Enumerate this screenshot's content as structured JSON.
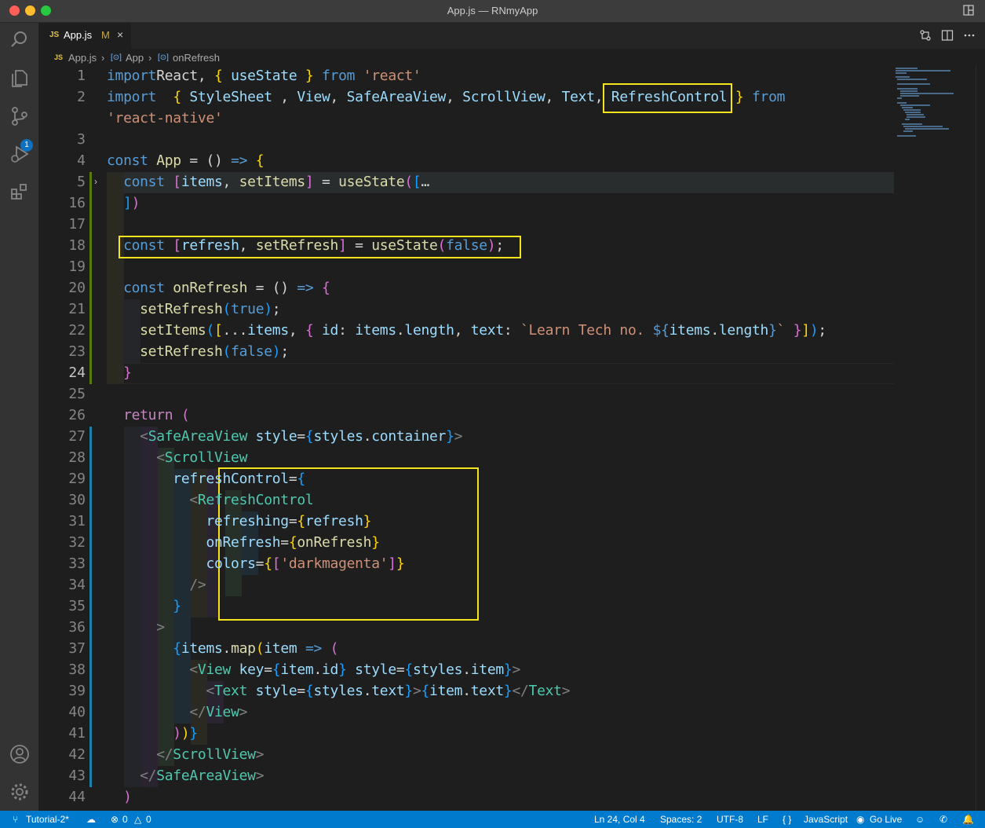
{
  "window": {
    "title": "App.js — RNmyApp"
  },
  "activity_bar": {
    "items": [
      "search-icon",
      "files-icon",
      "source-control-icon",
      "run-debug-icon",
      "extensions-icon",
      "account-icon",
      "settings-gear-icon"
    ],
    "source_control_badge": "1"
  },
  "tab": {
    "lang_badge": "JS",
    "name": "App.js",
    "modified": "M",
    "close": "×"
  },
  "breadcrumb": {
    "file_badge": "JS",
    "file": "App.js",
    "sym_badge": "[⊙]",
    "symbol1": "App",
    "symbol2": "onRefresh",
    "sep": "›"
  },
  "editor": {
    "lines": [
      {
        "n": "1",
        "tokens": [
          [
            "kw",
            "import"
          ],
          [
            "",
            "React, "
          ],
          [
            "br1",
            "{"
          ],
          [
            "var",
            " useState "
          ],
          [
            "br1",
            "}"
          ],
          [
            "kw",
            " from "
          ],
          [
            "str",
            "'react'"
          ]
        ]
      },
      {
        "n": "2",
        "tokens": [
          [
            "kw",
            "import"
          ],
          [
            "",
            "  "
          ],
          [
            "br1",
            "{"
          ],
          [
            "var",
            " StyleSheet"
          ],
          [
            "",
            " , "
          ],
          [
            "var",
            "View"
          ],
          [
            "",
            ", "
          ],
          [
            "var",
            "SafeAreaView"
          ],
          [
            "",
            ", "
          ],
          [
            "var",
            "ScrollView"
          ],
          [
            "",
            ", "
          ],
          [
            "var",
            "Text"
          ],
          [
            "",
            ", "
          ],
          [
            "var",
            "RefreshControl"
          ],
          [
            "",
            ""
          ],
          [
            "br1",
            " }"
          ],
          [
            "kw",
            " from"
          ]
        ]
      },
      {
        "n": "",
        "tokens": [
          [
            "str",
            "'react-native'"
          ]
        ]
      },
      {
        "n": "3",
        "tokens": []
      },
      {
        "n": "4",
        "tokens": [
          [
            "kw",
            "const "
          ],
          [
            "fn",
            "App"
          ],
          [
            "",
            " = () "
          ],
          [
            "kw",
            "=>"
          ],
          [
            "br1",
            " {"
          ]
        ]
      },
      {
        "n": "5",
        "tokens": [
          [
            "kw",
            "  const "
          ],
          [
            "br2",
            "["
          ],
          [
            "var",
            "items"
          ],
          [
            "",
            ", "
          ],
          [
            "fn",
            "setItems"
          ],
          [
            "br2",
            "]"
          ],
          [
            "",
            " = "
          ],
          [
            "fn",
            "useState"
          ],
          [
            "br2",
            "("
          ],
          [
            "br3",
            "["
          ],
          [
            "",
            "…"
          ]
        ]
      },
      {
        "n": "16",
        "tokens": [
          [
            "br3",
            "  ]"
          ],
          [
            "br2",
            ")"
          ]
        ]
      },
      {
        "n": "17",
        "tokens": []
      },
      {
        "n": "18",
        "tokens": [
          [
            "kw",
            "  const "
          ],
          [
            "br2",
            "["
          ],
          [
            "var",
            "refresh"
          ],
          [
            "",
            ", "
          ],
          [
            "fn",
            "setRefresh"
          ],
          [
            "br2",
            "]"
          ],
          [
            "",
            " = "
          ],
          [
            "fn",
            "useState"
          ],
          [
            "br2",
            "("
          ],
          [
            "kw",
            "false"
          ],
          [
            "br2",
            ")"
          ],
          [
            "",
            ";"
          ]
        ]
      },
      {
        "n": "19",
        "tokens": []
      },
      {
        "n": "20",
        "tokens": [
          [
            "kw",
            "  const "
          ],
          [
            "fn",
            "onRefresh"
          ],
          [
            "",
            " = () "
          ],
          [
            "kw",
            "=>"
          ],
          [
            "br2",
            " {"
          ]
        ]
      },
      {
        "n": "21",
        "tokens": [
          [
            "fn",
            "    setRefresh"
          ],
          [
            "br3",
            "("
          ],
          [
            "kw",
            "true"
          ],
          [
            "br3",
            ")"
          ],
          [
            "",
            ";"
          ]
        ]
      },
      {
        "n": "22",
        "tokens": [
          [
            "fn",
            "    setItems"
          ],
          [
            "br3",
            "("
          ],
          [
            "br1",
            "["
          ],
          [
            "",
            "..."
          ],
          [
            "var",
            "items"
          ],
          [
            "",
            ", "
          ],
          [
            "br2",
            "{"
          ],
          [
            "var",
            " id"
          ],
          [
            "",
            ": "
          ],
          [
            "var",
            "items"
          ],
          [
            "",
            "."
          ],
          [
            "var",
            "length"
          ],
          [
            "",
            ", "
          ],
          [
            "var",
            "text"
          ],
          [
            "",
            ": "
          ],
          [
            "str",
            "`Learn Tech no. "
          ],
          [
            "kw",
            "${"
          ],
          [
            "var",
            "items"
          ],
          [
            "",
            "."
          ],
          [
            "var",
            "length"
          ],
          [
            "kw",
            "}"
          ],
          [
            "str",
            "`"
          ],
          [
            "br2",
            " }"
          ],
          [
            "br1",
            "]"
          ],
          [
            "br3",
            ")"
          ],
          [
            "",
            ";"
          ]
        ]
      },
      {
        "n": "23",
        "tokens": [
          [
            "fn",
            "    setRefresh"
          ],
          [
            "br3",
            "("
          ],
          [
            "kw",
            "false"
          ],
          [
            "br3",
            ")"
          ],
          [
            "",
            ";"
          ]
        ]
      },
      {
        "n": "24",
        "tokens": [
          [
            "br2",
            "  }"
          ]
        ]
      },
      {
        "n": "25",
        "tokens": []
      },
      {
        "n": "26",
        "tokens": [
          [
            "ctl",
            "  return"
          ],
          [
            "br2",
            " ("
          ]
        ]
      },
      {
        "n": "27",
        "tokens": [
          [
            "tagp",
            "    <"
          ],
          [
            "cls",
            "SafeAreaView"
          ],
          [
            "var",
            " style"
          ],
          [
            "",
            "="
          ],
          [
            "br3",
            "{"
          ],
          [
            "var",
            "styles"
          ],
          [
            "",
            "."
          ],
          [
            "var",
            "container"
          ],
          [
            "br3",
            "}"
          ],
          [
            "tagp",
            ">"
          ]
        ]
      },
      {
        "n": "28",
        "tokens": [
          [
            "tagp",
            "      <"
          ],
          [
            "cls",
            "ScrollView"
          ]
        ]
      },
      {
        "n": "29",
        "tokens": [
          [
            "var",
            "        refreshControl"
          ],
          [
            "",
            "="
          ],
          [
            "br3",
            "{"
          ]
        ]
      },
      {
        "n": "30",
        "tokens": [
          [
            "tagp",
            "          <"
          ],
          [
            "cls",
            "RefreshControl"
          ]
        ]
      },
      {
        "n": "31",
        "tokens": [
          [
            "var",
            "            refreshing"
          ],
          [
            "",
            "="
          ],
          [
            "br1",
            "{"
          ],
          [
            "var",
            "refresh"
          ],
          [
            "br1",
            "}"
          ]
        ]
      },
      {
        "n": "32",
        "tokens": [
          [
            "var",
            "            onRefresh"
          ],
          [
            "",
            "="
          ],
          [
            "br1",
            "{"
          ],
          [
            "fn",
            "onRefresh"
          ],
          [
            "br1",
            "}"
          ]
        ]
      },
      {
        "n": "33",
        "tokens": [
          [
            "var",
            "            colors"
          ],
          [
            "",
            "="
          ],
          [
            "br1",
            "{"
          ],
          [
            "br2",
            "["
          ],
          [
            "str",
            "'darkmagenta'"
          ],
          [
            "br2",
            "]"
          ],
          [
            "br1",
            "}"
          ]
        ]
      },
      {
        "n": "34",
        "tokens": [
          [
            "tagp",
            "          />"
          ]
        ]
      },
      {
        "n": "35",
        "tokens": [
          [
            "br3",
            "        }"
          ]
        ]
      },
      {
        "n": "36",
        "tokens": [
          [
            "tagp",
            "      >"
          ]
        ]
      },
      {
        "n": "37",
        "tokens": [
          [
            "br3",
            "        {"
          ],
          [
            "var",
            "items"
          ],
          [
            "",
            "."
          ],
          [
            "fn",
            "map"
          ],
          [
            "br1",
            "("
          ],
          [
            "var",
            "item"
          ],
          [
            "kw",
            " =>"
          ],
          [
            "br2",
            " ("
          ]
        ]
      },
      {
        "n": "38",
        "tokens": [
          [
            "tagp",
            "          <"
          ],
          [
            "cls",
            "View"
          ],
          [
            "var",
            " key"
          ],
          [
            "",
            "="
          ],
          [
            "br3",
            "{"
          ],
          [
            "var",
            "item"
          ],
          [
            "",
            "."
          ],
          [
            "var",
            "id"
          ],
          [
            "br3",
            "}"
          ],
          [
            "var",
            " style"
          ],
          [
            "",
            "="
          ],
          [
            "br3",
            "{"
          ],
          [
            "var",
            "styles"
          ],
          [
            "",
            "."
          ],
          [
            "var",
            "item"
          ],
          [
            "br3",
            "}"
          ],
          [
            "tagp",
            ">"
          ]
        ]
      },
      {
        "n": "39",
        "tokens": [
          [
            "tagp",
            "            <"
          ],
          [
            "cls",
            "Text"
          ],
          [
            "var",
            " style"
          ],
          [
            "",
            "="
          ],
          [
            "br3",
            "{"
          ],
          [
            "var",
            "styles"
          ],
          [
            "",
            "."
          ],
          [
            "var",
            "text"
          ],
          [
            "br3",
            "}"
          ],
          [
            "tagp",
            ">"
          ],
          [
            "br3",
            "{"
          ],
          [
            "var",
            "item"
          ],
          [
            "",
            "."
          ],
          [
            "var",
            "text"
          ],
          [
            "br3",
            "}"
          ],
          [
            "tagp",
            "</"
          ],
          [
            "cls",
            "Text"
          ],
          [
            "tagp",
            ">"
          ]
        ]
      },
      {
        "n": "40",
        "tokens": [
          [
            "tagp",
            "          </"
          ],
          [
            "cls",
            "View"
          ],
          [
            "tagp",
            ">"
          ]
        ]
      },
      {
        "n": "41",
        "tokens": [
          [
            "br2",
            "        )"
          ],
          [
            "br1",
            ")"
          ],
          [
            "br3",
            "}"
          ]
        ]
      },
      {
        "n": "42",
        "tokens": [
          [
            "tagp",
            "      </"
          ],
          [
            "cls",
            "ScrollView"
          ],
          [
            "tagp",
            ">"
          ]
        ]
      },
      {
        "n": "43",
        "tokens": [
          [
            "tagp",
            "    </"
          ],
          [
            "cls",
            "SafeAreaView"
          ],
          [
            "tagp",
            ">"
          ]
        ]
      },
      {
        "n": "44",
        "tokens": [
          [
            "br2",
            "  )"
          ]
        ]
      }
    ]
  },
  "status_bar": {
    "branch": "Tutorial-2*",
    "errors": "0",
    "warnings": "0",
    "position": "Ln 24, Col 4",
    "spaces": "Spaces: 2",
    "encoding": "UTF-8",
    "eol": "LF",
    "lang_badge": "{ }",
    "language": "JavaScript",
    "golive": "Go Live"
  },
  "colors": {
    "accent": "#007acc",
    "highlight_box": "#f5e31b"
  }
}
